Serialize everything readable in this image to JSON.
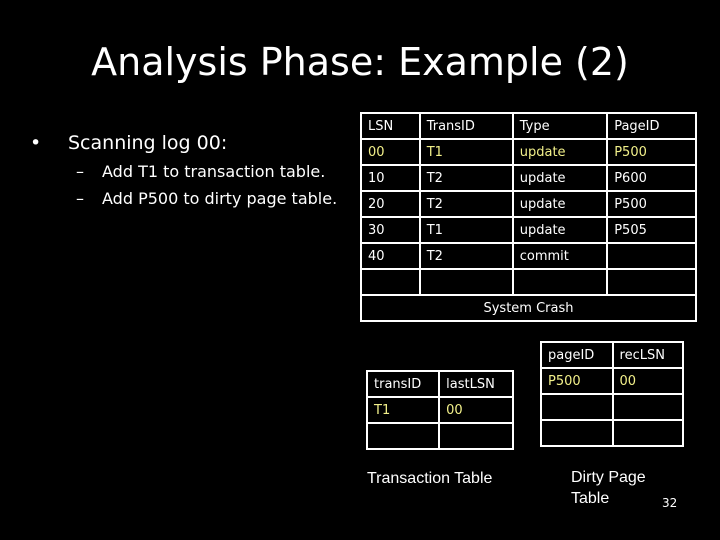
{
  "title": "Analysis Phase: Example (2)",
  "bullet": {
    "text": "Scanning log 00:",
    "subs": [
      "Add T1 to transaction table.",
      "Add P500 to dirty page table."
    ]
  },
  "log_table": {
    "headers": [
      "LSN",
      "TransID",
      "Type",
      "PageID"
    ],
    "rows": [
      {
        "cells": [
          "00",
          "T1",
          "update",
          "P500"
        ],
        "highlighted": true
      },
      {
        "cells": [
          "10",
          "T2",
          "update",
          "P600"
        ],
        "highlighted": false
      },
      {
        "cells": [
          "20",
          "T2",
          "update",
          "P500"
        ],
        "highlighted": false
      },
      {
        "cells": [
          "30",
          "T1",
          "update",
          "P505"
        ],
        "highlighted": false
      },
      {
        "cells": [
          "40",
          "T2",
          "commit",
          ""
        ],
        "highlighted": false
      }
    ],
    "footer": "System Crash"
  },
  "transaction_table": {
    "headers": [
      "transID",
      "lastLSN"
    ],
    "rows": [
      [
        "T1",
        "00"
      ]
    ],
    "caption": "Transaction Table"
  },
  "dirty_page_table": {
    "headers": [
      "pageID",
      "recLSN"
    ],
    "rows": [
      [
        "P500",
        "00"
      ]
    ],
    "caption_line1": "Dirty Page",
    "caption_line2": "Table"
  },
  "highlight_color": "#f2f08a",
  "page_number": "32"
}
